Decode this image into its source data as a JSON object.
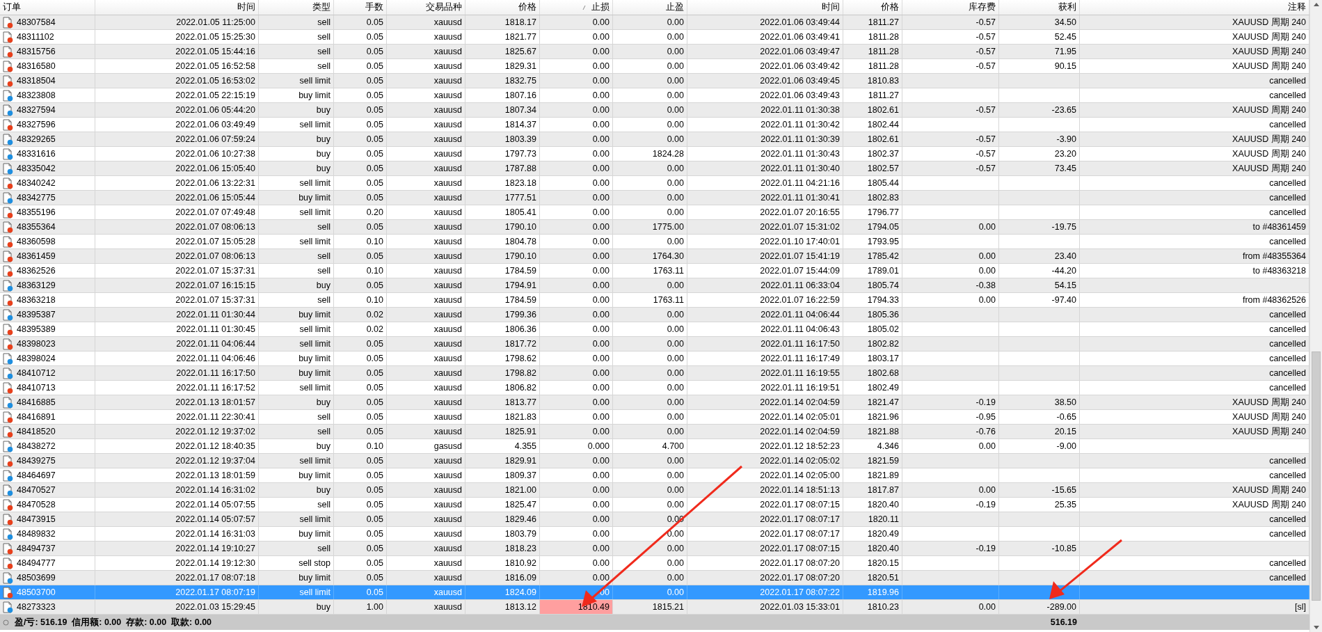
{
  "table": {
    "columns": [
      {
        "label": "订单",
        "sorted": false
      },
      {
        "label": "时间",
        "sorted": false
      },
      {
        "label": "类型",
        "sorted": false
      },
      {
        "label": "手数",
        "sorted": false
      },
      {
        "label": "交易品种",
        "sorted": false
      },
      {
        "label": "价格",
        "sorted": false
      },
      {
        "label": "止损",
        "sorted": true
      },
      {
        "label": "止盈",
        "sorted": false
      },
      {
        "label": "时间",
        "sorted": false
      },
      {
        "label": "价格",
        "sorted": false
      },
      {
        "label": "库存费",
        "sorted": false
      },
      {
        "label": "获利",
        "sorted": false
      },
      {
        "label": "注释",
        "sorted": false
      }
    ],
    "rows": [
      {
        "order": "48307584",
        "open_time": "2022.01.05 11:25:00",
        "type": "sell",
        "lots": "0.05",
        "symbol": "xauusd",
        "price": "1818.17",
        "sl": "0.00",
        "tp": "0.00",
        "close_time": "2022.01.06 03:49:44",
        "close_price": "1811.27",
        "swap": "-0.57",
        "profit": "34.50",
        "comment": "XAUUSD 周期 240",
        "color": "#e8401c",
        "selected": false,
        "sl_hit": false
      },
      {
        "order": "48311102",
        "open_time": "2022.01.05 15:25:30",
        "type": "sell",
        "lots": "0.05",
        "symbol": "xauusd",
        "price": "1821.77",
        "sl": "0.00",
        "tp": "0.00",
        "close_time": "2022.01.06 03:49:41",
        "close_price": "1811.28",
        "swap": "-0.57",
        "profit": "52.45",
        "comment": "XAUUSD 周期 240",
        "color": "#e8401c",
        "selected": false,
        "sl_hit": false
      },
      {
        "order": "48315756",
        "open_time": "2022.01.05 15:44:16",
        "type": "sell",
        "lots": "0.05",
        "symbol": "xauusd",
        "price": "1825.67",
        "sl": "0.00",
        "tp": "0.00",
        "close_time": "2022.01.06 03:49:47",
        "close_price": "1811.28",
        "swap": "-0.57",
        "profit": "71.95",
        "comment": "XAUUSD 周期 240",
        "color": "#e8401c",
        "selected": false,
        "sl_hit": false
      },
      {
        "order": "48316580",
        "open_time": "2022.01.05 16:52:58",
        "type": "sell",
        "lots": "0.05",
        "symbol": "xauusd",
        "price": "1829.31",
        "sl": "0.00",
        "tp": "0.00",
        "close_time": "2022.01.06 03:49:42",
        "close_price": "1811.28",
        "swap": "-0.57",
        "profit": "90.15",
        "comment": "XAUUSD 周期 240",
        "color": "#e8401c",
        "selected": false,
        "sl_hit": false
      },
      {
        "order": "48318504",
        "open_time": "2022.01.05 16:53:02",
        "type": "sell limit",
        "lots": "0.05",
        "symbol": "xauusd",
        "price": "1832.75",
        "sl": "0.00",
        "tp": "0.00",
        "close_time": "2022.01.06 03:49:45",
        "close_price": "1810.83",
        "comment": "cancelled",
        "color": "#e8401c",
        "selected": false,
        "sl_hit": false
      },
      {
        "order": "48323808",
        "open_time": "2022.01.05 22:15:19",
        "type": "buy limit",
        "lots": "0.05",
        "symbol": "xauusd",
        "price": "1807.16",
        "sl": "0.00",
        "tp": "0.00",
        "close_time": "2022.01.06 03:49:43",
        "close_price": "1811.27",
        "comment": "cancelled",
        "color": "#1e8fe0",
        "selected": false,
        "sl_hit": false
      },
      {
        "order": "48327594",
        "open_time": "2022.01.06 05:44:20",
        "type": "buy",
        "lots": "0.05",
        "symbol": "xauusd",
        "price": "1807.34",
        "sl": "0.00",
        "tp": "0.00",
        "close_time": "2022.01.11 01:30:38",
        "close_price": "1802.61",
        "swap": "-0.57",
        "profit": "-23.65",
        "comment": "XAUUSD 周期 240",
        "color": "#1e8fe0",
        "selected": false,
        "sl_hit": false
      },
      {
        "order": "48327596",
        "open_time": "2022.01.06 03:49:49",
        "type": "sell limit",
        "lots": "0.05",
        "symbol": "xauusd",
        "price": "1814.37",
        "sl": "0.00",
        "tp": "0.00",
        "close_time": "2022.01.11 01:30:42",
        "close_price": "1802.44",
        "comment": "cancelled",
        "color": "#e8401c",
        "selected": false,
        "sl_hit": false
      },
      {
        "order": "48329265",
        "open_time": "2022.01.06 07:59:24",
        "type": "buy",
        "lots": "0.05",
        "symbol": "xauusd",
        "price": "1803.39",
        "sl": "0.00",
        "tp": "0.00",
        "close_time": "2022.01.11 01:30:39",
        "close_price": "1802.61",
        "swap": "-0.57",
        "profit": "-3.90",
        "comment": "XAUUSD 周期 240",
        "color": "#1e8fe0",
        "selected": false,
        "sl_hit": false
      },
      {
        "order": "48331616",
        "open_time": "2022.01.06 10:27:38",
        "type": "buy",
        "lots": "0.05",
        "symbol": "xauusd",
        "price": "1797.73",
        "sl": "0.00",
        "tp": "1824.28",
        "close_time": "2022.01.11 01:30:43",
        "close_price": "1802.37",
        "swap": "-0.57",
        "profit": "23.20",
        "comment": "XAUUSD 周期 240",
        "color": "#1e8fe0",
        "selected": false,
        "sl_hit": false
      },
      {
        "order": "48335042",
        "open_time": "2022.01.06 15:05:40",
        "type": "buy",
        "lots": "0.05",
        "symbol": "xauusd",
        "price": "1787.88",
        "sl": "0.00",
        "tp": "0.00",
        "close_time": "2022.01.11 01:30:40",
        "close_price": "1802.57",
        "swap": "-0.57",
        "profit": "73.45",
        "comment": "XAUUSD 周期 240",
        "color": "#1e8fe0",
        "selected": false,
        "sl_hit": false
      },
      {
        "order": "48340242",
        "open_time": "2022.01.06 13:22:31",
        "type": "sell limit",
        "lots": "0.05",
        "symbol": "xauusd",
        "price": "1823.18",
        "sl": "0.00",
        "tp": "0.00",
        "close_time": "2022.01.11 04:21:16",
        "close_price": "1805.44",
        "comment": "cancelled",
        "color": "#e8401c",
        "selected": false,
        "sl_hit": false
      },
      {
        "order": "48342775",
        "open_time": "2022.01.06 15:05:44",
        "type": "buy limit",
        "lots": "0.05",
        "symbol": "xauusd",
        "price": "1777.51",
        "sl": "0.00",
        "tp": "0.00",
        "close_time": "2022.01.11 01:30:41",
        "close_price": "1802.83",
        "comment": "cancelled",
        "color": "#1e8fe0",
        "selected": false,
        "sl_hit": false
      },
      {
        "order": "48355196",
        "open_time": "2022.01.07 07:49:48",
        "type": "sell limit",
        "lots": "0.20",
        "symbol": "xauusd",
        "price": "1805.41",
        "sl": "0.00",
        "tp": "0.00",
        "close_time": "2022.01.07 20:16:55",
        "close_price": "1796.77",
        "comment": "cancelled",
        "color": "#e8401c",
        "selected": false,
        "sl_hit": false
      },
      {
        "order": "48355364",
        "open_time": "2022.01.07 08:06:13",
        "type": "sell",
        "lots": "0.05",
        "symbol": "xauusd",
        "price": "1790.10",
        "sl": "0.00",
        "tp": "1775.00",
        "close_time": "2022.01.07 15:31:02",
        "close_price": "1794.05",
        "swap": "0.00",
        "profit": "-19.75",
        "comment": "to #48361459",
        "color": "#e8401c",
        "selected": false,
        "sl_hit": false
      },
      {
        "order": "48360598",
        "open_time": "2022.01.07 15:05:28",
        "type": "sell limit",
        "lots": "0.10",
        "symbol": "xauusd",
        "price": "1804.78",
        "sl": "0.00",
        "tp": "0.00",
        "close_time": "2022.01.10 17:40:01",
        "close_price": "1793.95",
        "comment": "cancelled",
        "color": "#e8401c",
        "selected": false,
        "sl_hit": false
      },
      {
        "order": "48361459",
        "open_time": "2022.01.07 08:06:13",
        "type": "sell",
        "lots": "0.05",
        "symbol": "xauusd",
        "price": "1790.10",
        "sl": "0.00",
        "tp": "1764.30",
        "close_time": "2022.01.07 15:41:19",
        "close_price": "1785.42",
        "swap": "0.00",
        "profit": "23.40",
        "comment": "from #48355364",
        "color": "#e8401c",
        "selected": false,
        "sl_hit": false
      },
      {
        "order": "48362526",
        "open_time": "2022.01.07 15:37:31",
        "type": "sell",
        "lots": "0.10",
        "symbol": "xauusd",
        "price": "1784.59",
        "sl": "0.00",
        "tp": "1763.11",
        "close_time": "2022.01.07 15:44:09",
        "close_price": "1789.01",
        "swap": "0.00",
        "profit": "-44.20",
        "comment": "to #48363218",
        "color": "#e8401c",
        "selected": false,
        "sl_hit": false
      },
      {
        "order": "48363129",
        "open_time": "2022.01.07 16:15:15",
        "type": "buy",
        "lots": "0.05",
        "symbol": "xauusd",
        "price": "1794.91",
        "sl": "0.00",
        "tp": "0.00",
        "close_time": "2022.01.11 06:33:04",
        "close_price": "1805.74",
        "swap": "-0.38",
        "profit": "54.15",
        "color": "#1e8fe0",
        "selected": false,
        "sl_hit": false
      },
      {
        "order": "48363218",
        "open_time": "2022.01.07 15:37:31",
        "type": "sell",
        "lots": "0.10",
        "symbol": "xauusd",
        "price": "1784.59",
        "sl": "0.00",
        "tp": "1763.11",
        "close_time": "2022.01.07 16:22:59",
        "close_price": "1794.33",
        "swap": "0.00",
        "profit": "-97.40",
        "comment": "from #48362526",
        "color": "#e8401c",
        "selected": false,
        "sl_hit": false
      },
      {
        "order": "48395387",
        "open_time": "2022.01.11 01:30:44",
        "type": "buy limit",
        "lots": "0.02",
        "symbol": "xauusd",
        "price": "1799.36",
        "sl": "0.00",
        "tp": "0.00",
        "close_time": "2022.01.11 04:06:44",
        "close_price": "1805.36",
        "comment": "cancelled",
        "color": "#1e8fe0",
        "selected": false,
        "sl_hit": false
      },
      {
        "order": "48395389",
        "open_time": "2022.01.11 01:30:45",
        "type": "sell limit",
        "lots": "0.02",
        "symbol": "xauusd",
        "price": "1806.36",
        "sl": "0.00",
        "tp": "0.00",
        "close_time": "2022.01.11 04:06:43",
        "close_price": "1805.02",
        "comment": "cancelled",
        "color": "#e8401c",
        "selected": false,
        "sl_hit": false
      },
      {
        "order": "48398023",
        "open_time": "2022.01.11 04:06:44",
        "type": "sell limit",
        "lots": "0.05",
        "symbol": "xauusd",
        "price": "1817.72",
        "sl": "0.00",
        "tp": "0.00",
        "close_time": "2022.01.11 16:17:50",
        "close_price": "1802.82",
        "comment": "cancelled",
        "color": "#e8401c",
        "selected": false,
        "sl_hit": false
      },
      {
        "order": "48398024",
        "open_time": "2022.01.11 04:06:46",
        "type": "buy limit",
        "lots": "0.05",
        "symbol": "xauusd",
        "price": "1798.62",
        "sl": "0.00",
        "tp": "0.00",
        "close_time": "2022.01.11 16:17:49",
        "close_price": "1803.17",
        "comment": "cancelled",
        "color": "#1e8fe0",
        "selected": false,
        "sl_hit": false
      },
      {
        "order": "48410712",
        "open_time": "2022.01.11 16:17:50",
        "type": "buy limit",
        "lots": "0.05",
        "symbol": "xauusd",
        "price": "1798.82",
        "sl": "0.00",
        "tp": "0.00",
        "close_time": "2022.01.11 16:19:55",
        "close_price": "1802.68",
        "comment": "cancelled",
        "color": "#1e8fe0",
        "selected": false,
        "sl_hit": false
      },
      {
        "order": "48410713",
        "open_time": "2022.01.11 16:17:52",
        "type": "sell limit",
        "lots": "0.05",
        "symbol": "xauusd",
        "price": "1806.82",
        "sl": "0.00",
        "tp": "0.00",
        "close_time": "2022.01.11 16:19:51",
        "close_price": "1802.49",
        "comment": "cancelled",
        "color": "#e8401c",
        "selected": false,
        "sl_hit": false
      },
      {
        "order": "48416885",
        "open_time": "2022.01.13 18:01:57",
        "type": "buy",
        "lots": "0.05",
        "symbol": "xauusd",
        "price": "1813.77",
        "sl": "0.00",
        "tp": "0.00",
        "close_time": "2022.01.14 02:04:59",
        "close_price": "1821.47",
        "swap": "-0.19",
        "profit": "38.50",
        "comment": "XAUUSD 周期 240",
        "color": "#1e8fe0",
        "selected": false,
        "sl_hit": false
      },
      {
        "order": "48416891",
        "open_time": "2022.01.11 22:30:41",
        "type": "sell",
        "lots": "0.05",
        "symbol": "xauusd",
        "price": "1821.83",
        "sl": "0.00",
        "tp": "0.00",
        "close_time": "2022.01.14 02:05:01",
        "close_price": "1821.96",
        "swap": "-0.95",
        "profit": "-0.65",
        "comment": "XAUUSD 周期 240",
        "color": "#e8401c",
        "selected": false,
        "sl_hit": false
      },
      {
        "order": "48418520",
        "open_time": "2022.01.12 19:37:02",
        "type": "sell",
        "lots": "0.05",
        "symbol": "xauusd",
        "price": "1825.91",
        "sl": "0.00",
        "tp": "0.00",
        "close_time": "2022.01.14 02:04:59",
        "close_price": "1821.88",
        "swap": "-0.76",
        "profit": "20.15",
        "comment": "XAUUSD 周期 240",
        "color": "#e8401c",
        "selected": false,
        "sl_hit": false
      },
      {
        "order": "48438272",
        "open_time": "2022.01.12 18:40:35",
        "type": "buy",
        "lots": "0.10",
        "symbol": "gasusd",
        "price": "4.355",
        "sl": "0.000",
        "tp": "4.700",
        "close_time": "2022.01.12 18:52:23",
        "close_price": "4.346",
        "swap": "0.00",
        "profit": "-9.00",
        "color": "#1e8fe0",
        "selected": false,
        "sl_hit": false
      },
      {
        "order": "48439275",
        "open_time": "2022.01.12 19:37:04",
        "type": "sell limit",
        "lots": "0.05",
        "symbol": "xauusd",
        "price": "1829.91",
        "sl": "0.00",
        "tp": "0.00",
        "close_time": "2022.01.14 02:05:02",
        "close_price": "1821.59",
        "comment": "cancelled",
        "color": "#e8401c",
        "selected": false,
        "sl_hit": false
      },
      {
        "order": "48464697",
        "open_time": "2022.01.13 18:01:59",
        "type": "buy limit",
        "lots": "0.05",
        "symbol": "xauusd",
        "price": "1809.37",
        "sl": "0.00",
        "tp": "0.00",
        "close_time": "2022.01.14 02:05:00",
        "close_price": "1821.89",
        "comment": "cancelled",
        "color": "#1e8fe0",
        "selected": false,
        "sl_hit": false
      },
      {
        "order": "48470527",
        "open_time": "2022.01.14 16:31:02",
        "type": "buy",
        "lots": "0.05",
        "symbol": "xauusd",
        "price": "1821.00",
        "sl": "0.00",
        "tp": "0.00",
        "close_time": "2022.01.14 18:51:13",
        "close_price": "1817.87",
        "swap": "0.00",
        "profit": "-15.65",
        "comment": "XAUUSD 周期 240",
        "color": "#1e8fe0",
        "selected": false,
        "sl_hit": false
      },
      {
        "order": "48470528",
        "open_time": "2022.01.14 05:07:55",
        "type": "sell",
        "lots": "0.05",
        "symbol": "xauusd",
        "price": "1825.47",
        "sl": "0.00",
        "tp": "0.00",
        "close_time": "2022.01.17 08:07:15",
        "close_price": "1820.40",
        "swap": "-0.19",
        "profit": "25.35",
        "comment": "XAUUSD 周期 240",
        "color": "#e8401c",
        "selected": false,
        "sl_hit": false
      },
      {
        "order": "48473915",
        "open_time": "2022.01.14 05:07:57",
        "type": "sell limit",
        "lots": "0.05",
        "symbol": "xauusd",
        "price": "1829.46",
        "sl": "0.00",
        "tp": "0.00",
        "close_time": "2022.01.17 08:07:17",
        "close_price": "1820.11",
        "comment": "cancelled",
        "color": "#e8401c",
        "selected": false,
        "sl_hit": false
      },
      {
        "order": "48489832",
        "open_time": "2022.01.14 16:31:03",
        "type": "buy limit",
        "lots": "0.05",
        "symbol": "xauusd",
        "price": "1803.79",
        "sl": "0.00",
        "tp": "0.00",
        "close_time": "2022.01.17 08:07:17",
        "close_price": "1820.49",
        "comment": "cancelled",
        "color": "#1e8fe0",
        "selected": false,
        "sl_hit": false
      },
      {
        "order": "48494737",
        "open_time": "2022.01.14 19:10:27",
        "type": "sell",
        "lots": "0.05",
        "symbol": "xauusd",
        "price": "1818.23",
        "sl": "0.00",
        "tp": "0.00",
        "close_time": "2022.01.17 08:07:15",
        "close_price": "1820.40",
        "swap": "-0.19",
        "profit": "-10.85",
        "color": "#e8401c",
        "selected": false,
        "sl_hit": false
      },
      {
        "order": "48494777",
        "open_time": "2022.01.14 19:12:30",
        "type": "sell stop",
        "lots": "0.05",
        "symbol": "xauusd",
        "price": "1810.92",
        "sl": "0.00",
        "tp": "0.00",
        "close_time": "2022.01.17 08:07:20",
        "close_price": "1820.15",
        "comment": "cancelled",
        "color": "#e8401c",
        "selected": false,
        "sl_hit": false
      },
      {
        "order": "48503699",
        "open_time": "2022.01.17 08:07:18",
        "type": "buy limit",
        "lots": "0.05",
        "symbol": "xauusd",
        "price": "1816.09",
        "sl": "0.00",
        "tp": "0.00",
        "close_time": "2022.01.17 08:07:20",
        "close_price": "1820.51",
        "comment": "cancelled",
        "color": "#1e8fe0",
        "selected": false,
        "sl_hit": false
      },
      {
        "order": "48503700",
        "open_time": "2022.01.17 08:07:19",
        "type": "sell limit",
        "lots": "0.05",
        "symbol": "xauusd",
        "price": "1824.09",
        "sl": "00",
        "tp": "0.00",
        "close_time": "2022.01.17 08:07:22",
        "close_price": "1819.96",
        "color": "#e8401c",
        "selected": true,
        "sl_hit": false
      },
      {
        "order": "48273323",
        "open_time": "2022.01.03 15:29:45",
        "type": "buy",
        "lots": "1.00",
        "symbol": "xauusd",
        "price": "1813.12",
        "sl": "1810.49",
        "tp": "1815.21",
        "close_time": "2022.01.03 15:33:01",
        "close_price": "1810.23",
        "swap": "0.00",
        "profit": "-289.00",
        "comment": "[sl]",
        "color": "#1e8fe0",
        "selected": false,
        "sl_hit": true
      }
    ]
  },
  "summary": {
    "text": "盈/亏: 516.19  信用额: 0.00  存款: 0.00  取款: 0.00",
    "total_profit": "516.19"
  }
}
